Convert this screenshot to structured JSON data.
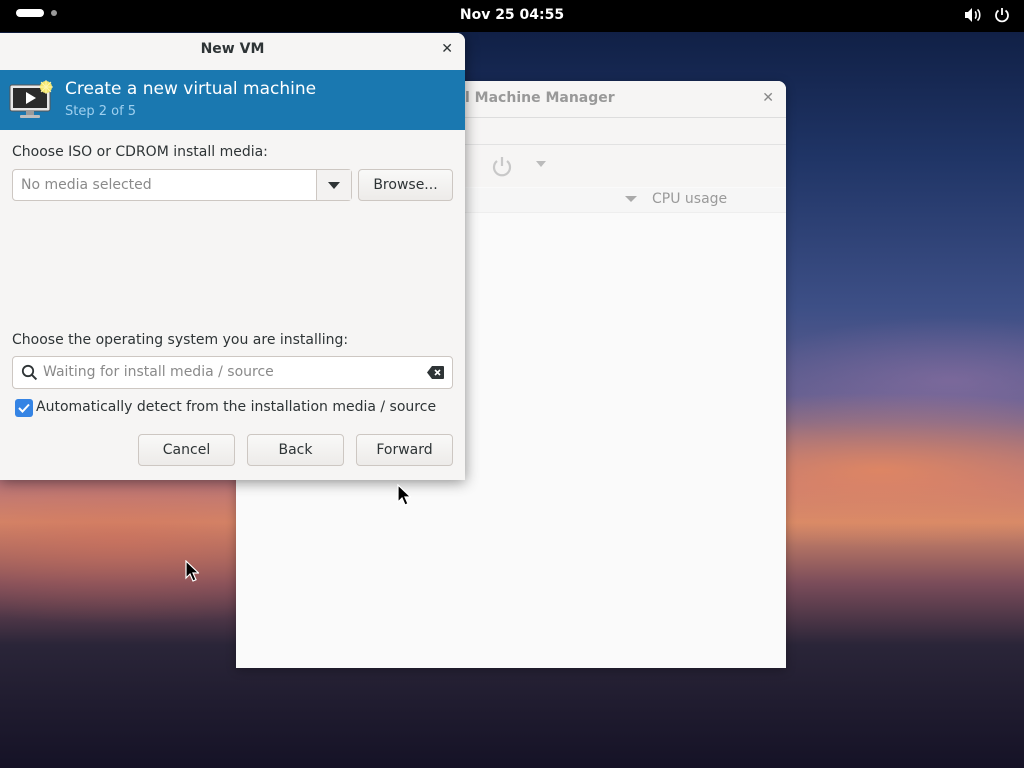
{
  "topbar": {
    "clock": "Nov 25  04:55",
    "icons": [
      "activities-indicator",
      "volume-icon",
      "power-icon"
    ]
  },
  "background_window": {
    "title": "l Machine Manager",
    "column_header": "CPU usage"
  },
  "dialog": {
    "title": "New VM",
    "header": {
      "title": "Create a new virtual machine",
      "step": "Step 2 of 5"
    },
    "media": {
      "label": "Choose ISO or CDROM install media:",
      "value": "No media selected",
      "browse_label": "Browse..."
    },
    "os": {
      "label": "Choose the operating system you are installing:",
      "placeholder": "Waiting for install media / source",
      "auto_detect_label": "Automatically detect from the installation media / source",
      "auto_detect_checked": true
    },
    "buttons": {
      "cancel": "Cancel",
      "back": "Back",
      "forward": "Forward"
    }
  },
  "colors": {
    "banner": "#1a78b0",
    "accent": "#3584e4"
  }
}
